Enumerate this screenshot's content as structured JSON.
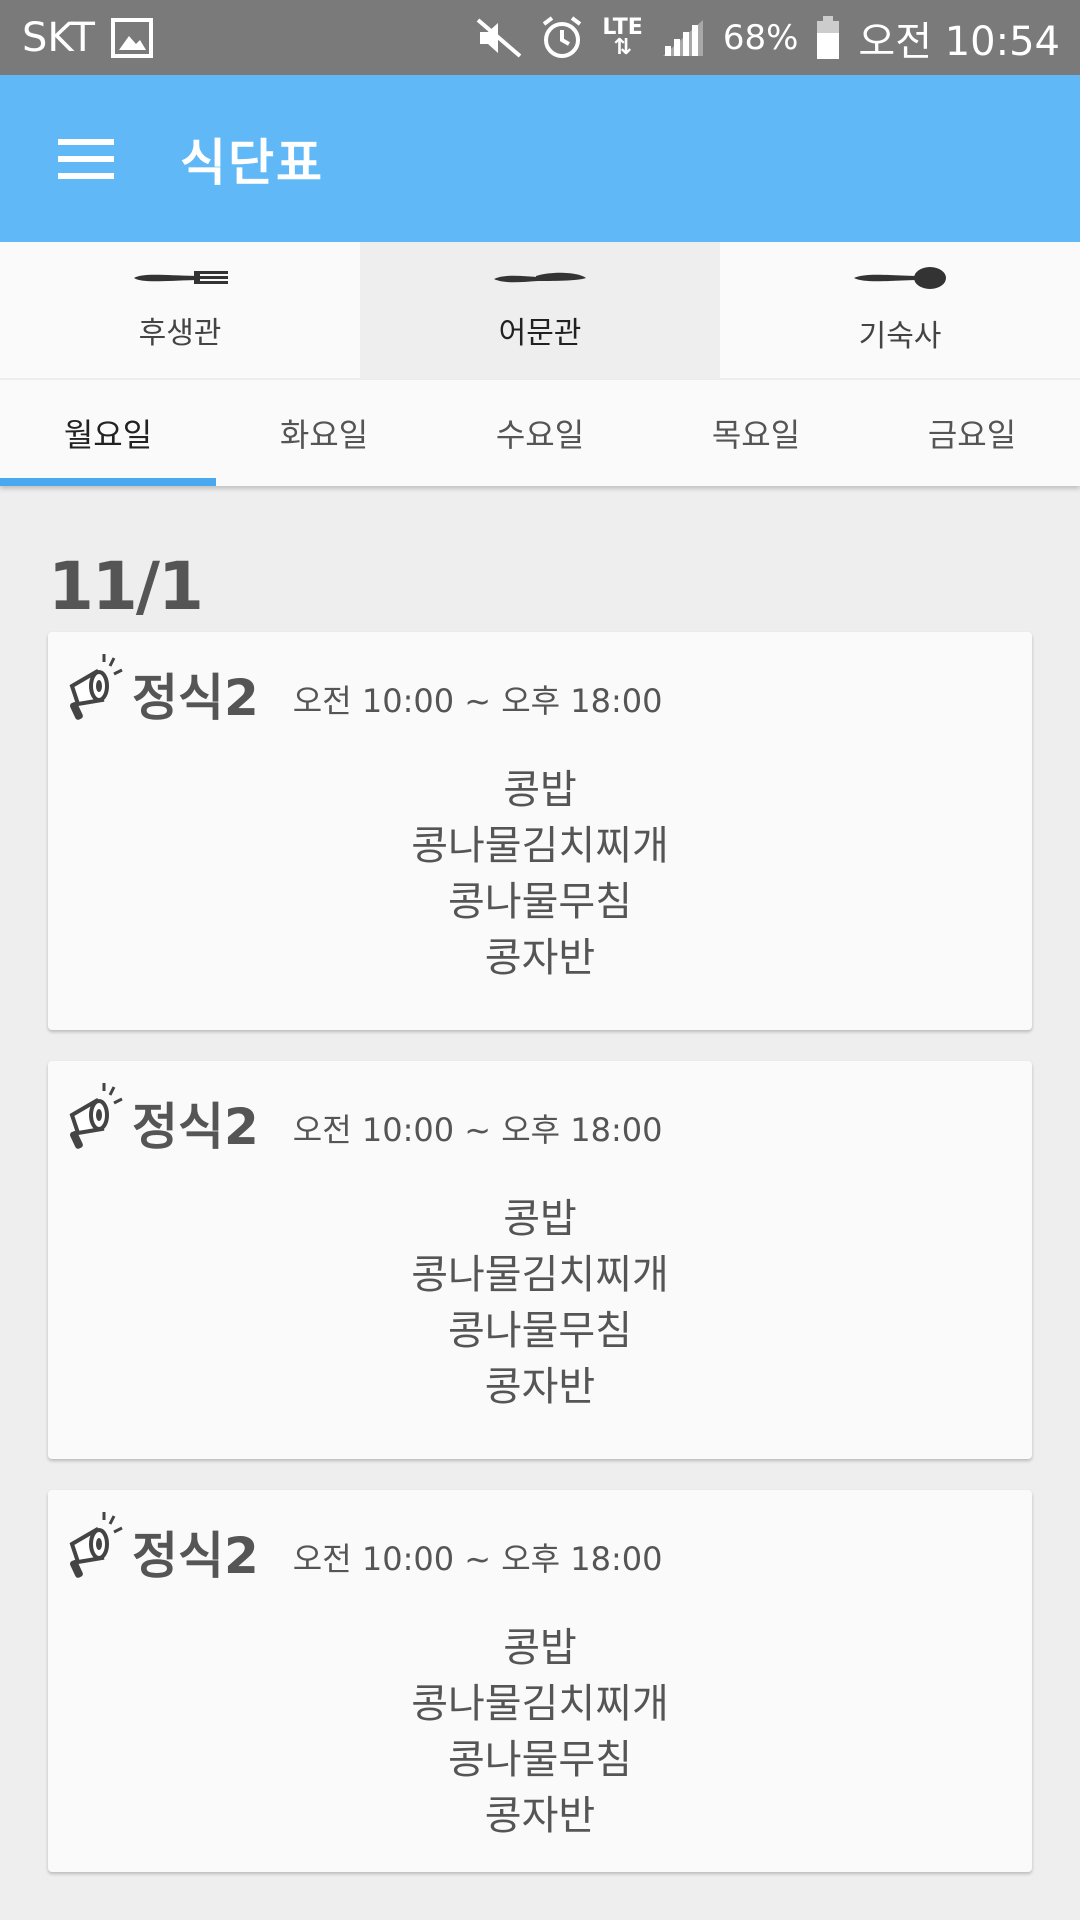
{
  "status_bar": {
    "carrier": "SKT",
    "network": "LTE",
    "battery": "68%",
    "time": "오전 10:54",
    "icons": [
      "gallery-icon",
      "mute-icon",
      "alarm-icon",
      "lte-icon",
      "signal-icon",
      "battery-icon"
    ]
  },
  "app_bar": {
    "title": "식단표",
    "menu_icon": "hamburger-icon",
    "background": "#60b8f7"
  },
  "cafeteria_tabs": [
    {
      "label": "후생관",
      "icon": "fork-icon",
      "active": false
    },
    {
      "label": "어문관",
      "icon": "knife-icon",
      "active": true
    },
    {
      "label": "기숙사",
      "icon": "spoon-icon",
      "active": false
    }
  ],
  "day_tabs": [
    {
      "label": "월요일",
      "active": true
    },
    {
      "label": "화요일",
      "active": false
    },
    {
      "label": "수요일",
      "active": false
    },
    {
      "label": "목요일",
      "active": false
    },
    {
      "label": "금요일",
      "active": false
    }
  ],
  "date": "11/1",
  "cards": [
    {
      "name": "정식2",
      "time": "오전 10:00 ~ 오후 18:00",
      "menu": [
        "콩밥",
        "콩나물김치찌개",
        "콩나물무침",
        "콩자반"
      ]
    },
    {
      "name": "정식2",
      "time": "오전 10:00 ~ 오후 18:00",
      "menu": [
        "콩밥",
        "콩나물김치찌개",
        "콩나물무침",
        "콩자반"
      ]
    },
    {
      "name": "정식2",
      "time": "오전 10:00 ~ 오후 18:00",
      "menu": [
        "콩밥",
        "콩나물김치찌개",
        "콩나물무침",
        "콩자반"
      ]
    }
  ],
  "colors": {
    "accent": "#60b8f7",
    "indicator": "#4aa8ee"
  }
}
